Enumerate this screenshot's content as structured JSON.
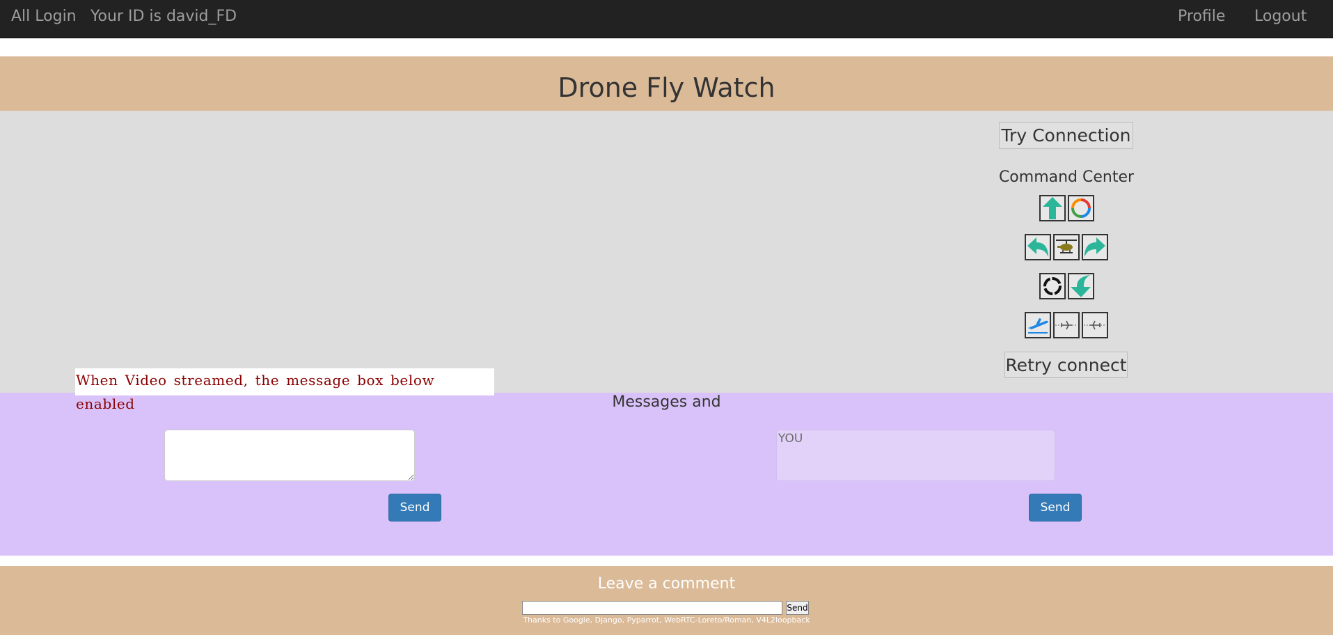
{
  "navbar": {
    "brand": "All Login",
    "user_id_text": "Your ID is david_FD",
    "profile_label": "Profile",
    "logout_label": "Logout"
  },
  "header": {
    "title": "Drone Fly Watch"
  },
  "controls": {
    "try_connection_label": "Try Connection",
    "command_center_title": "Command Center",
    "retry_label": "Retry connect",
    "buttons": [
      {
        "name": "up-arrow-icon"
      },
      {
        "name": "rotate-colored-icon"
      },
      {
        "name": "turn-left-arrow-icon"
      },
      {
        "name": "helicopter-icon"
      },
      {
        "name": "turn-right-arrow-icon"
      },
      {
        "name": "rotate-black-icon"
      },
      {
        "name": "down-arrow-icon"
      },
      {
        "name": "takeoff-plane-icon"
      },
      {
        "name": "plane-left-icon"
      },
      {
        "name": "plane-right-icon"
      }
    ],
    "colors": {
      "arrow": "#2bb69a",
      "panel_bg": "#dddddd"
    }
  },
  "notice": {
    "text": "When Video streamed, the message box below enabled"
  },
  "messages": {
    "title": "Messages and",
    "left_value": "",
    "right_label": "YOU",
    "send_label_left": "Send",
    "send_label_right": "Send",
    "colors": {
      "band": "#d9c2f9",
      "button": "#337ab7"
    }
  },
  "footer": {
    "title": "Leave a comment",
    "comment_value": "",
    "send_label": "Send",
    "credits": "Thanks to Google, Django, Pyparrot, WebRTC-Loreto/Roman, V4L2loopback",
    "colors": {
      "band": "#dbba98"
    }
  }
}
